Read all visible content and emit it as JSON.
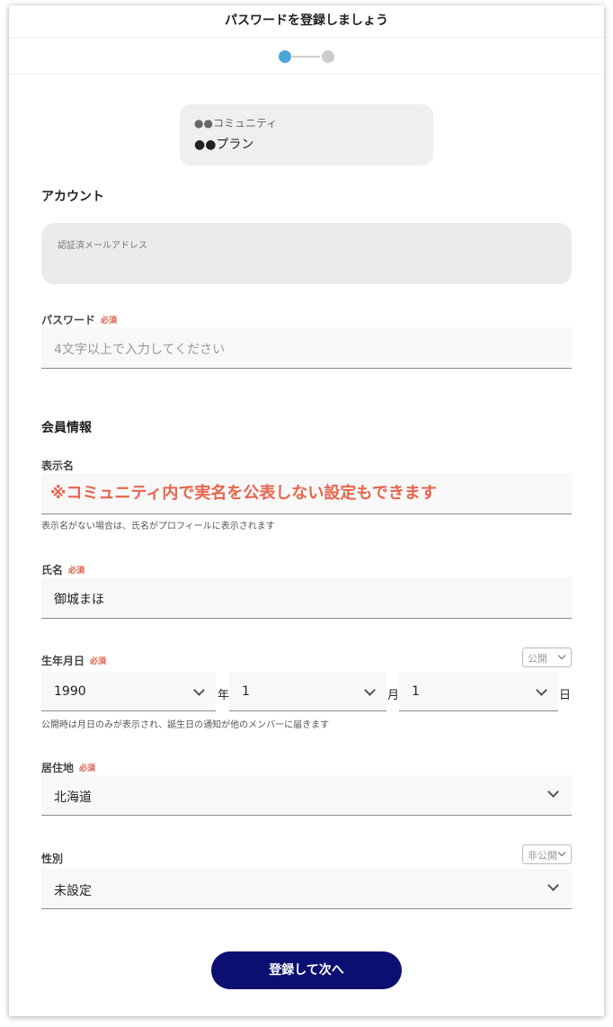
{
  "header": {
    "title": "パスワードを登録しましょう"
  },
  "stepper": {
    "current_step": 1,
    "total_steps": 2
  },
  "plan": {
    "community": "●●コミュニティ",
    "plan_name": "●●プラン"
  },
  "account": {
    "section_title": "アカウント",
    "email": {
      "label": "認証済メールアドレス",
      "value": ""
    },
    "password": {
      "label": "パスワード",
      "required": "必須",
      "placeholder": "4文字以上で入力してください"
    }
  },
  "member": {
    "section_title": "会員情報",
    "display_name": {
      "label": "表示名",
      "annotation": "※コミュニティ内で実名を公表しない設定もできます",
      "help": "表示名がない場合は、氏名がプロフィールに表示されます"
    },
    "full_name": {
      "label": "氏名",
      "required": "必須",
      "value": "御城まほ"
    },
    "birthday": {
      "label": "生年月日",
      "required": "必須",
      "visibility": "公開",
      "year": "1990",
      "year_unit": "年",
      "month": "1",
      "month_unit": "月",
      "day": "1",
      "day_unit": "日",
      "help": "公開時は月日のみが表示され、誕生日の通知が他のメンバーに届きます"
    },
    "residence": {
      "label": "居住地",
      "required": "必須",
      "value": "北海道"
    },
    "gender": {
      "label": "性別",
      "visibility": "非公開",
      "value": "未設定"
    }
  },
  "submit": {
    "label": "登録して次へ"
  },
  "colors": {
    "accent": "#4ba4da",
    "required": "#e05a47",
    "annotation": "#e8644d",
    "button": "#0b0f72"
  }
}
